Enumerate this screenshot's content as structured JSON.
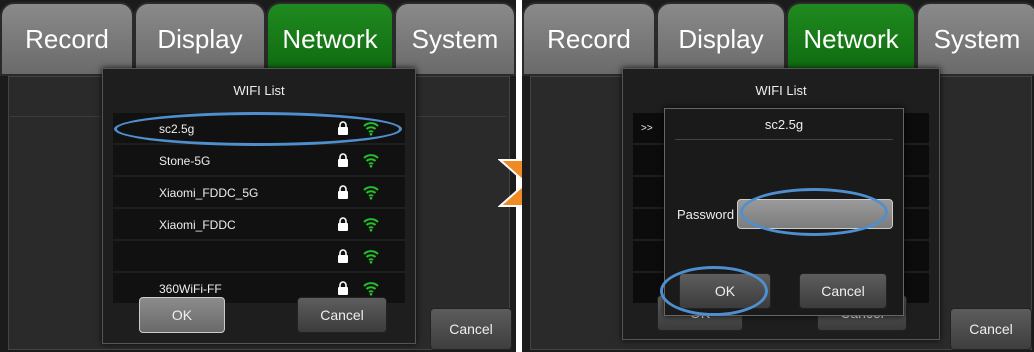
{
  "tabs": [
    "Record",
    "Display",
    "Network",
    "System"
  ],
  "left": {
    "dialog_title": "WIFI List",
    "networks": [
      "sc2.5g",
      "Stone-5G",
      "Xiaomi_FDDC_5G",
      "Xiaomi_FDDC",
      "",
      "360WiFi-FF"
    ],
    "ok_label": "OK",
    "cancel_label": "Cancel",
    "bg_cancel_label": "Cancel"
  },
  "right": {
    "dialog_title": "WIFI List",
    "row_marker": ">>",
    "password_dialog_title": "sc2.5g",
    "password_label": "Password",
    "password_value": "",
    "ok_label": "OK",
    "cancel_label": "Cancel",
    "bg_ok_label": "OK",
    "bg_cancel_label": "Cancel"
  },
  "colors": {
    "active_tab": "#128012",
    "highlight": "#4f8fd0",
    "arrow": "#f08a24",
    "wifi": "#22c02a"
  },
  "icons": {
    "lock": "lock-icon",
    "wifi": "wifi-signal-icon",
    "arrow": "next-step-arrow-icon"
  }
}
